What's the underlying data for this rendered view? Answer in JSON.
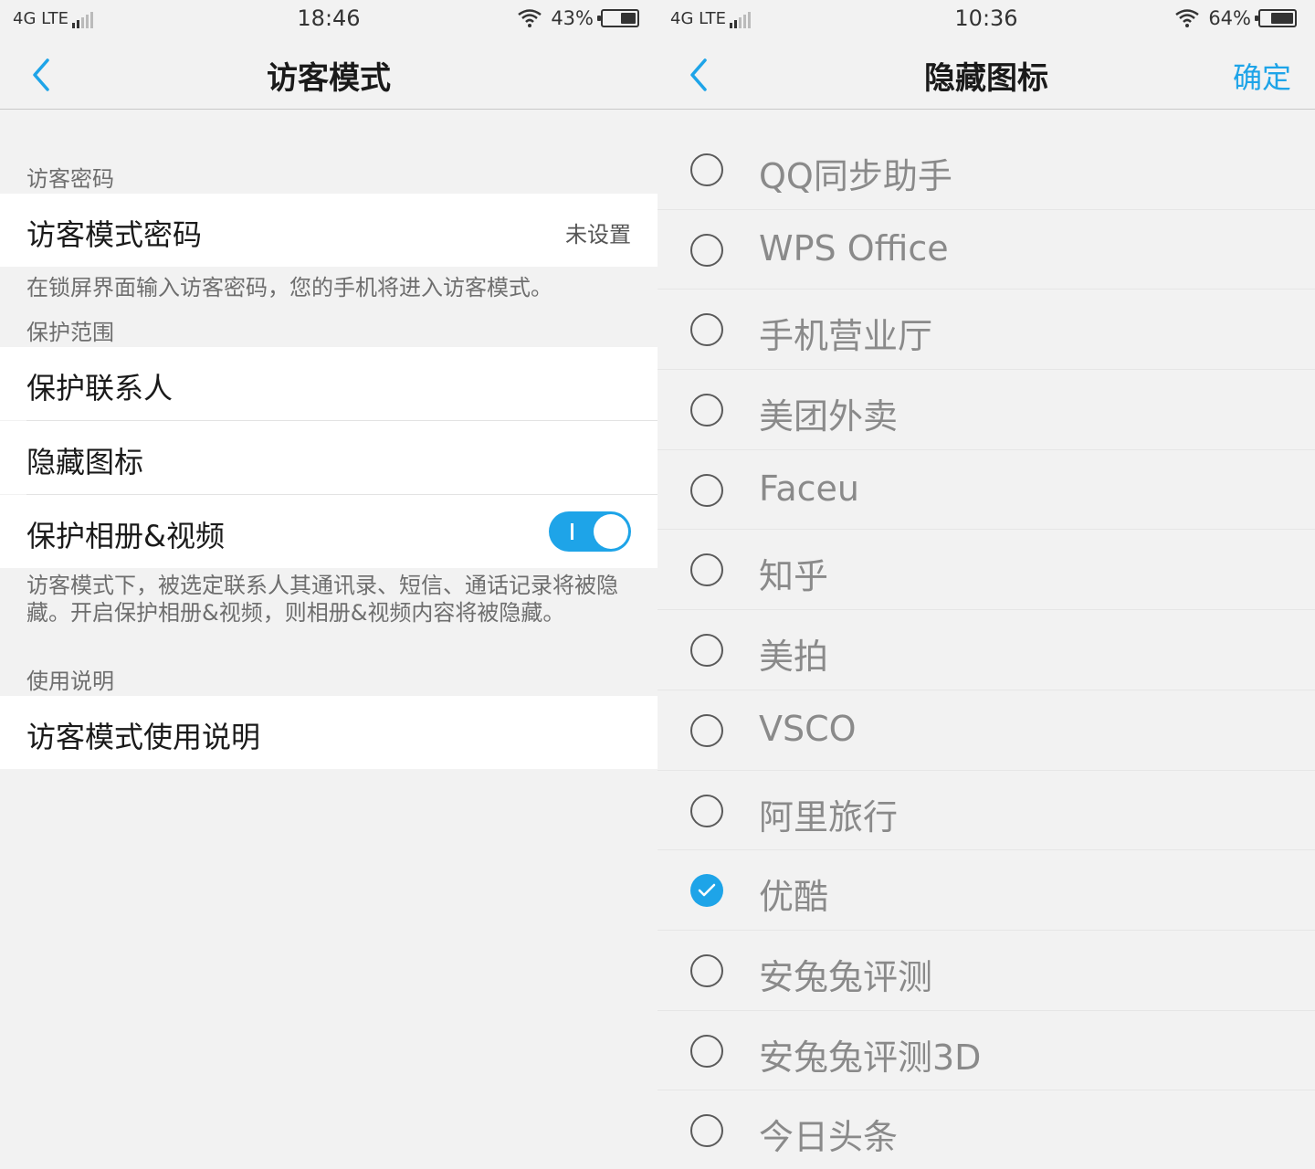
{
  "left": {
    "status": {
      "network": "4G LTE",
      "time": "18:46",
      "battery": "43%"
    },
    "nav": {
      "title": "访客模式"
    },
    "sections": {
      "password_header": "访客密码",
      "password_label": "访客模式密码",
      "password_value": "未设置",
      "password_desc": "在锁屏界面输入访客密码，您的手机将进入访客模式。",
      "protect_header": "保护范围",
      "protect_contacts": "保护联系人",
      "hide_icons": "隐藏图标",
      "protect_album": "保护相册&视频",
      "protect_desc": "访客模式下，被选定联系人其通讯录、短信、通话记录将被隐藏。开启保护相册&视频，则相册&视频内容将被隐藏。",
      "usage_header": "使用说明",
      "usage_label": "访客模式使用说明"
    },
    "toggle_album_on": true
  },
  "right": {
    "status": {
      "network": "4G LTE",
      "time": "10:36",
      "battery": "64%"
    },
    "nav": {
      "title": "隐藏图标",
      "confirm": "确定"
    },
    "apps": [
      {
        "name": "QQ同步助手",
        "checked": false
      },
      {
        "name": "WPS Office",
        "checked": false
      },
      {
        "name": "手机营业厅",
        "checked": false
      },
      {
        "name": "美团外卖",
        "checked": false
      },
      {
        "name": "Faceu",
        "checked": false
      },
      {
        "name": "知乎",
        "checked": false
      },
      {
        "name": "美拍",
        "checked": false
      },
      {
        "name": "VSCO",
        "checked": false
      },
      {
        "name": "阿里旅行",
        "checked": false
      },
      {
        "name": "优酷",
        "checked": true
      },
      {
        "name": "安兔兔评测",
        "checked": false
      },
      {
        "name": "安兔兔评测3D",
        "checked": false
      },
      {
        "name": "今日头条",
        "checked": false
      }
    ]
  },
  "colors": {
    "accent": "#1ea4e8",
    "background": "#f2f2f2",
    "row": "#ffffff"
  },
  "icons": [
    "back-arrow-icon",
    "wifi-icon",
    "signal-icon",
    "battery-icon",
    "check-icon"
  ]
}
